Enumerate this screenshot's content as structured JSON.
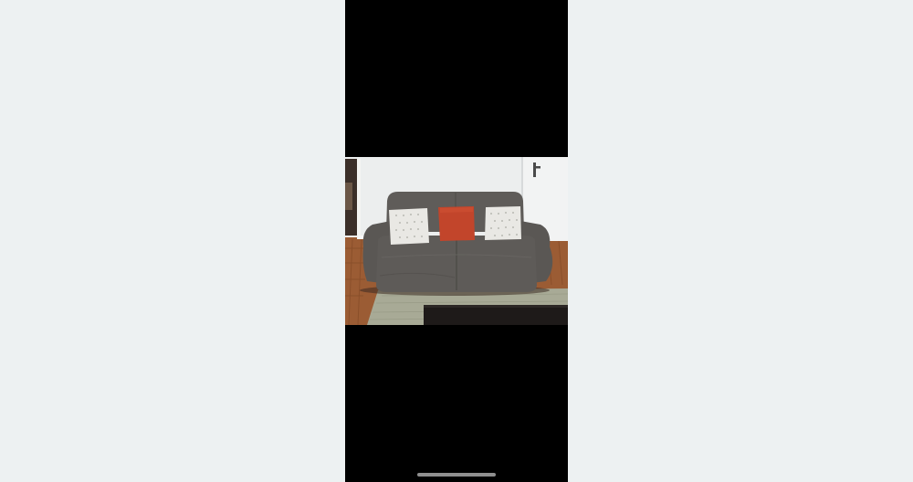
{
  "viewer": {
    "background_color": "#edf1f2",
    "screen_background_color": "#000000"
  },
  "photo": {
    "subject": "sofa-in-living-room",
    "colors": {
      "wall": "#eceeee",
      "sofa": "#5e5b58",
      "pillow_center": "#c2452b",
      "pillow_side": "#e9e8e4",
      "floor": "#9b5c34",
      "rug": "#a8aa96",
      "table": "#1e1a19"
    }
  },
  "home_indicator": {
    "color": "#8f8f8f"
  }
}
